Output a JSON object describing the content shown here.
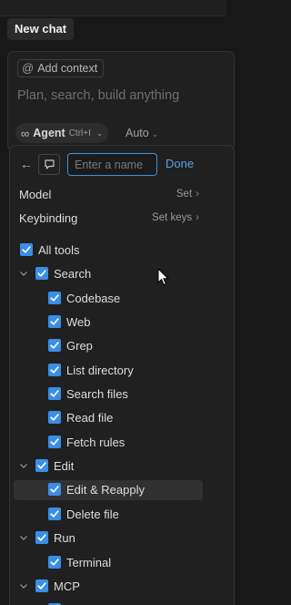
{
  "tab": {
    "title": "New chat"
  },
  "composer": {
    "context_chip": "Add context",
    "placeholder": "Plan, search, build anything",
    "agent": {
      "label": "Agent",
      "shortcut": "Ctrl+I"
    },
    "model_select": "Auto"
  },
  "popup": {
    "name_placeholder": "Enter a name",
    "done_label": "Done",
    "settings": [
      {
        "label": "Model",
        "value": "Set"
      },
      {
        "label": "Keybinding",
        "value": "Set keys"
      }
    ],
    "all_tools_label": "All tools",
    "groups": [
      {
        "label": "Search",
        "items": [
          "Codebase",
          "Web",
          "Grep",
          "List directory",
          "Search files",
          "Read file",
          "Fetch rules"
        ]
      },
      {
        "label": "Edit",
        "items": [
          "Edit & Reapply",
          "Delete file"
        ]
      },
      {
        "label": "Run",
        "items": [
          "Terminal"
        ]
      },
      {
        "label": "MCP",
        "items": []
      }
    ]
  },
  "colors": {
    "accent": "#3a8ee6",
    "link": "#5aa2e6",
    "background": "#181818",
    "panel": "#202020"
  }
}
